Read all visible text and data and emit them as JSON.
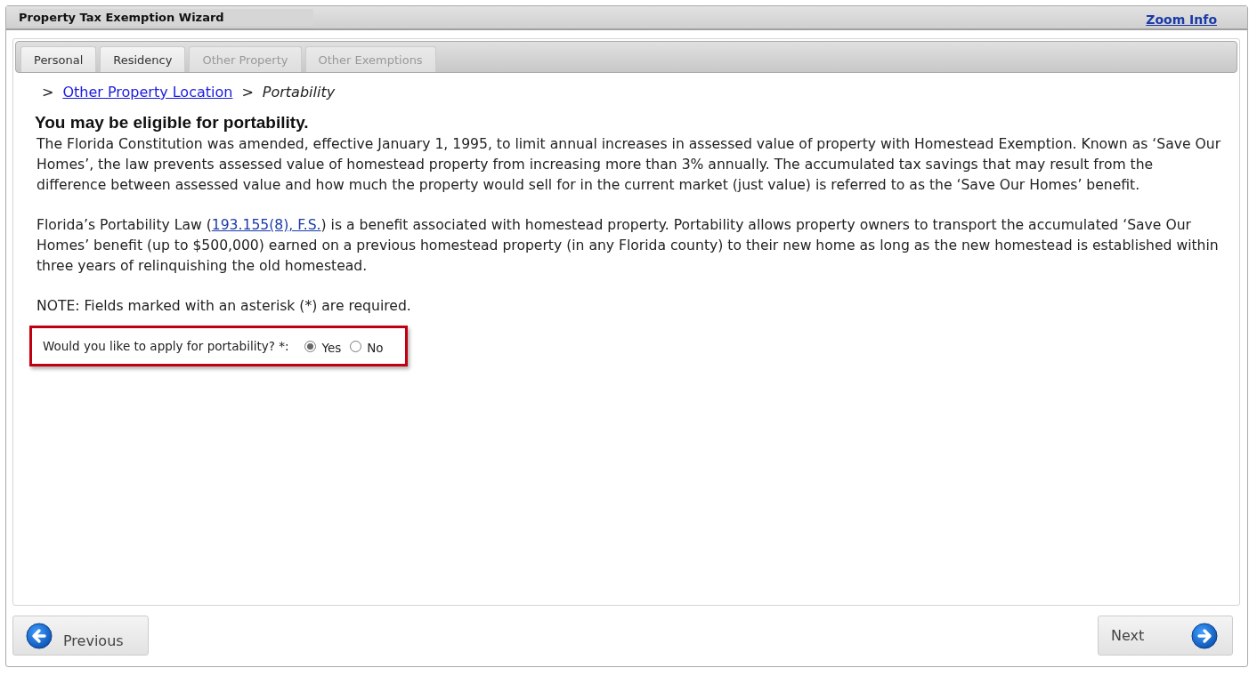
{
  "window": {
    "title": "Property Tax Exemption Wizard",
    "zoom_link": "Zoom Info"
  },
  "tabs": [
    {
      "label": "Personal",
      "disabled": false
    },
    {
      "label": "Residency",
      "disabled": false
    },
    {
      "label": "Other Property",
      "disabled": true
    },
    {
      "label": "Other Exemptions",
      "disabled": true
    }
  ],
  "breadcrumb": [
    {
      "separator": ">",
      "label": "Other Property Location",
      "kind": "link"
    },
    {
      "separator": ">",
      "label": "Portability",
      "kind": "current"
    }
  ],
  "heading": "You may be eligible for portability.",
  "paragraphs": [
    {
      "parts": [
        {
          "text": "The Florida Constitution was amended, effective January 1, 1995, to limit annual increases in assessed value of property with Homestead Exemption. Known as ‘Save Our Homes’, the law prevents assessed value of homestead property from increasing more than 3% annually. The accumulated tax savings that may result from the difference between assessed value and how much the property would sell for in the current market (just value) is referred to as the ‘Save Our Homes’ benefit.",
          "kind": "text"
        }
      ]
    },
    {
      "parts": [
        {
          "text": "Florida’s Portability Law (",
          "kind": "text"
        },
        {
          "text": "193.155(8), F.S.",
          "kind": "link"
        },
        {
          "text": ") is a benefit associated with homestead property. Portability allows property owners to transport the accumulated ‘Save Our Homes’ benefit (up to $500,000) earned on a previous homestead property (in any Florida county) to their new home as long as the new homestead is established within three years of relinquishing the old homestead.",
          "kind": "text"
        }
      ]
    },
    {
      "parts": [
        {
          "text": "NOTE: Fields marked with an asterisk (*) are required.",
          "kind": "text"
        }
      ]
    }
  ],
  "question": {
    "label": "Would you like to apply for portability? *:",
    "highlighted": true,
    "options": [
      {
        "label": "Yes",
        "selected": true
      },
      {
        "label": "No",
        "selected": false
      }
    ]
  },
  "buttons": {
    "previous": "Previous",
    "next": "Next"
  }
}
